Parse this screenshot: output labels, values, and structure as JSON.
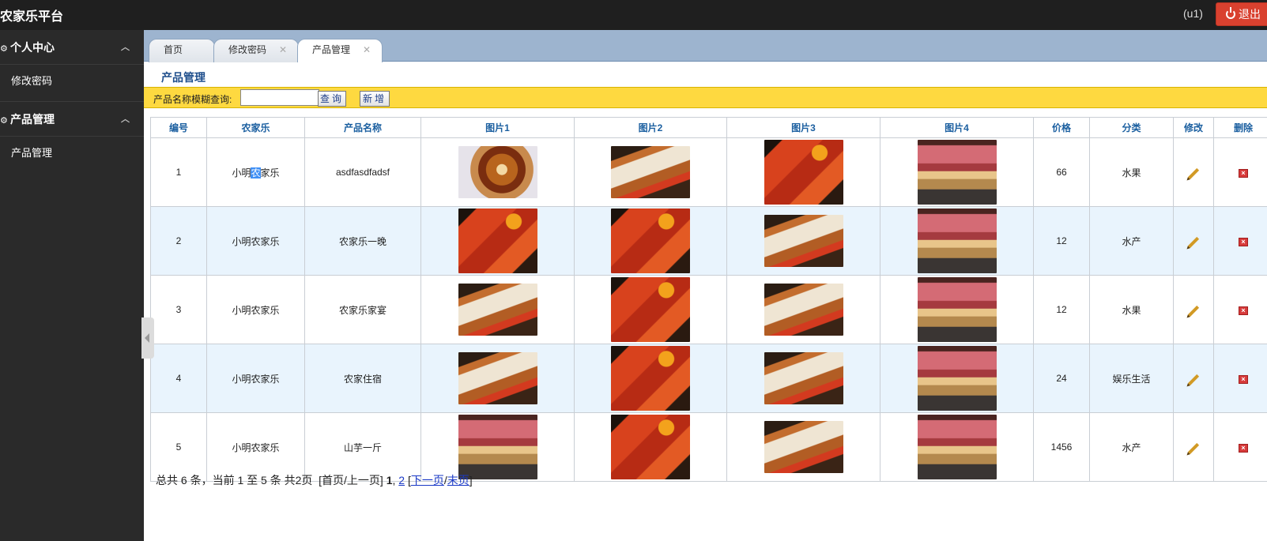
{
  "header": {
    "title": "农家乐平台",
    "user": "(u1)",
    "logout_label": "退出"
  },
  "sidebar": {
    "groups": [
      {
        "label": "个人中心",
        "items": [
          "修改密码"
        ]
      },
      {
        "label": "产品管理",
        "items": [
          "产品管理"
        ]
      }
    ]
  },
  "tabs": [
    {
      "label": "首页",
      "closable": false
    },
    {
      "label": "修改密码",
      "closable": true
    },
    {
      "label": "产品管理",
      "closable": true,
      "active": true
    }
  ],
  "panel": {
    "title": "产品管理"
  },
  "search": {
    "label": "产品名称模糊查询:",
    "value": "",
    "query_button": "查询",
    "add_button": "新增"
  },
  "table": {
    "columns": [
      "编号",
      "农家乐",
      "产品名称",
      "图片1",
      "图片2",
      "图片3",
      "图片4",
      "价格",
      "分类",
      "修改",
      "删除"
    ],
    "rows": [
      {
        "id": "1",
        "farm": "小明农家乐",
        "name": "asdfasdfadsf",
        "pics": [
          "platter",
          "grill",
          "fish",
          "meat"
        ],
        "price": "66",
        "category": "水果"
      },
      {
        "id": "2",
        "farm": "小明农家乐",
        "name": "农家乐一晚",
        "pics": [
          "fish",
          "fish",
          "grill",
          "meat"
        ],
        "price": "12",
        "category": "水产"
      },
      {
        "id": "3",
        "farm": "小明农家乐",
        "name": "农家乐家宴",
        "pics": [
          "grill",
          "fish",
          "grill",
          "meat"
        ],
        "price": "12",
        "category": "水果"
      },
      {
        "id": "4",
        "farm": "小明农家乐",
        "name": "农家住宿",
        "pics": [
          "grill",
          "fish",
          "grill",
          "meat"
        ],
        "price": "24",
        "category": "娱乐生活"
      },
      {
        "id": "5",
        "farm": "小明农家乐",
        "name": "山芋一斤",
        "pics": [
          "meat",
          "fish",
          "grill",
          "meat"
        ],
        "price": "1456",
        "category": "水产"
      }
    ]
  },
  "pager": {
    "summary": "总共 6 条，当前 1 至 5 条 共2页",
    "first_prev": "[首页/上一页]",
    "current": "1",
    "sep": ",",
    "page2": "2",
    "next": "下一页",
    "last": "末页"
  }
}
